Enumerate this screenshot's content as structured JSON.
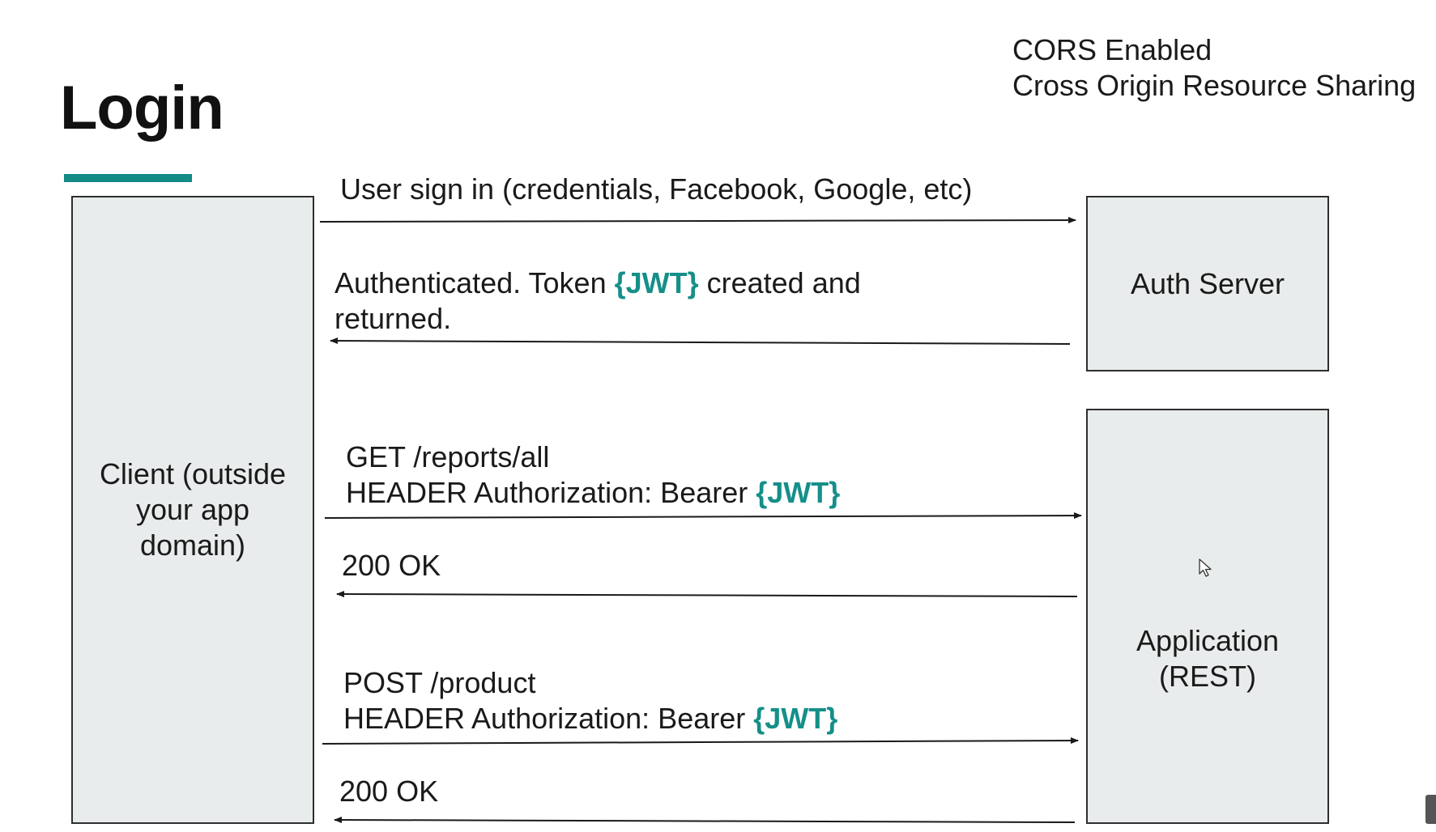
{
  "slide": {
    "title": "Login",
    "cors_note": {
      "line1": "CORS Enabled",
      "line2": "Cross Origin Resource Sharing"
    }
  },
  "actors": {
    "client": "Client (outside your app domain)",
    "auth_server": "Auth Server",
    "application": "Application (REST)"
  },
  "messages": {
    "m1": {
      "text": "User sign in (credentials, Facebook, Google, etc)",
      "direction": "client-to-auth-server"
    },
    "m2": {
      "prefix": "Authenticated. Token ",
      "token": "{JWT}",
      "suffix": " created and",
      "line2": "returned.",
      "direction": "auth-server-to-client"
    },
    "m3": {
      "line1": "GET /reports/all",
      "prefix": "HEADER Authorization: Bearer ",
      "token": "{JWT}",
      "direction": "client-to-application"
    },
    "m4": {
      "text": "200 OK",
      "direction": "application-to-client"
    },
    "m5": {
      "line1": "POST /product",
      "prefix": "HEADER Authorization: Bearer ",
      "token": "{JWT}",
      "direction": "client-to-application"
    },
    "m6": {
      "text": "200 OK",
      "direction": "application-to-client"
    }
  },
  "colors": {
    "accent": "#128a85",
    "token_highlight": "#158f89",
    "box_fill": "#e9ecec",
    "box_border": "#2e2e2e"
  }
}
